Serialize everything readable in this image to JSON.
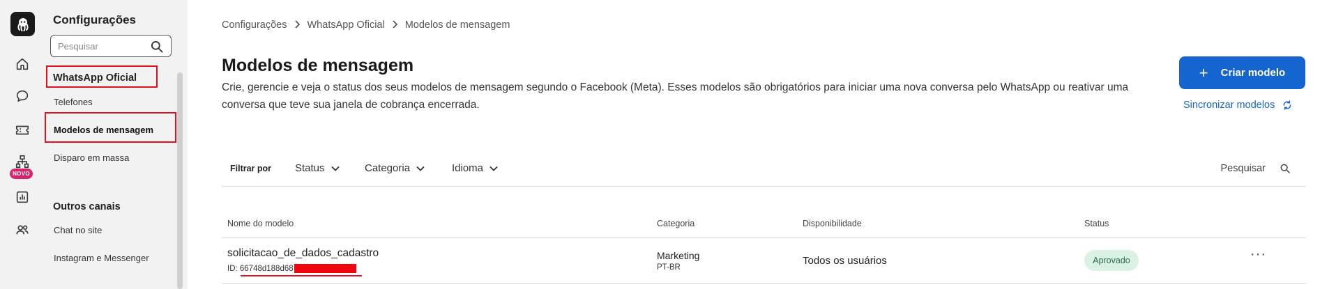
{
  "rail": {
    "badge_novo": "NOVO"
  },
  "sidebar": {
    "title": "Configurações",
    "search_placeholder": "Pesquisar",
    "section_whatsapp": "WhatsApp Oficial",
    "items_whatsapp": [
      "Telefones",
      "Modelos de mensagem",
      "Disparo em massa"
    ],
    "section_outros": "Outros canais",
    "items_outros": [
      "Chat no site",
      "Instagram e Messenger"
    ]
  },
  "breadcrumb": [
    "Configurações",
    "WhatsApp Oficial",
    "Modelos de mensagem"
  ],
  "page": {
    "title": "Modelos de mensagem",
    "description": "Crie, gerencie e veja o status dos seus modelos de mensagem segundo o Facebook (Meta). Esses modelos são obrigatórios para iniciar uma nova conversa pelo WhatsApp ou reativar uma conversa que teve sua janela de cobrança encerrada.",
    "create_button": "Criar modelo",
    "sync_link": "Sincronizar modelos"
  },
  "filters": {
    "label": "Filtrar por",
    "options": [
      "Status",
      "Categoria",
      "Idioma"
    ],
    "search_label": "Pesquisar"
  },
  "table": {
    "columns": [
      "Nome do modelo",
      "Categoria",
      "Disponibilidade",
      "Status"
    ],
    "rows": [
      {
        "name": "solicitacao_de_dados_cadastro",
        "id_label": "ID: 66748d188d68",
        "category": "Marketing",
        "language": "PT-BR",
        "availability": "Todos os usuários",
        "status": "Aprovado",
        "actions": "···"
      }
    ]
  },
  "colors": {
    "primary": "#1565d0",
    "highlight_red": "#e0121f",
    "status_approved_bg": "#d9f2e3",
    "status_approved_text": "#2d6b45",
    "badge_novo": "#d6246e"
  }
}
